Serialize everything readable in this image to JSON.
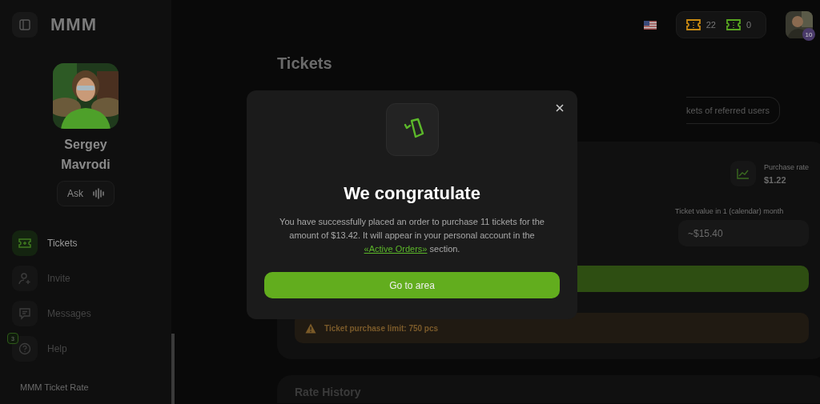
{
  "sidebar": {
    "logo": "MMM",
    "profile": {
      "name": "Sergey Mavrodi",
      "ask_label": "Ask"
    },
    "nav": [
      {
        "label": "Tickets",
        "selected": true,
        "kind": "tickets"
      },
      {
        "label": "Invite",
        "selected": false,
        "kind": "invite"
      },
      {
        "label": "Messages",
        "selected": false,
        "kind": "messages"
      },
      {
        "label": "Help",
        "selected": false,
        "kind": "help",
        "badge": "3"
      }
    ],
    "section_title": "MMM Ticket Rate"
  },
  "header": {
    "counters": [
      {
        "value": "22",
        "color": "#c98a12"
      },
      {
        "value": "0",
        "color": "#58a520"
      }
    ],
    "user_badge": "10"
  },
  "page": {
    "title": "Tickets",
    "tab": "kets of referred users",
    "card": {
      "rate_label": "Purchase rate",
      "rate_value": "$1.22",
      "value_label": "Ticket value in 1 (calendar) month",
      "value": "~$15.40",
      "warning": "Ticket purchase limit: 750 pcs"
    },
    "next_section": "Rate History"
  },
  "modal": {
    "title": "We congratulate",
    "message": "You have successfully placed an order to purchase 11 tickets for the amount of $13.42. It will appear in your personal account in the",
    "link": "«Active Orders»",
    "message_end": "section.",
    "button": "Go to area"
  }
}
